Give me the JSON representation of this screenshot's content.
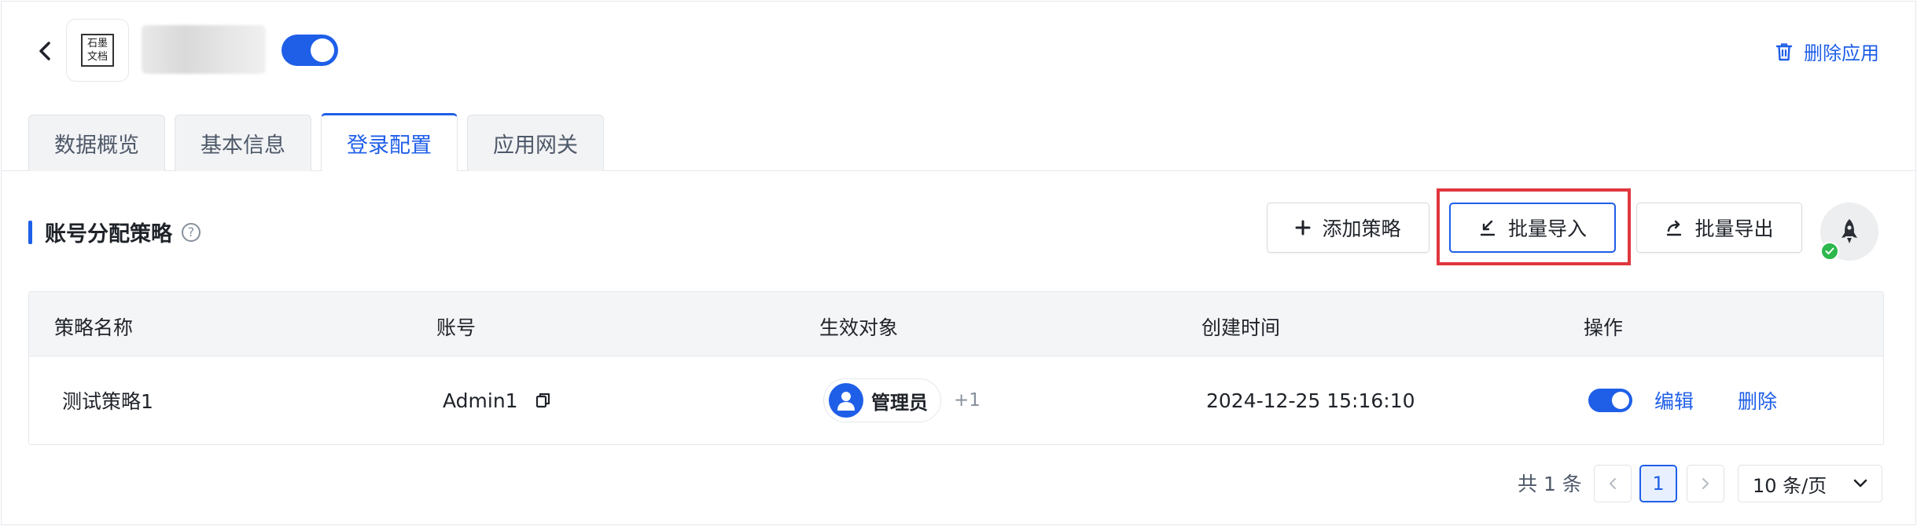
{
  "header": {
    "logo_text_line1": "石墨",
    "logo_text_line2": "文档",
    "app_enabled": true,
    "delete_app_label": "删除应用"
  },
  "tabs": [
    {
      "label": "数据概览",
      "active": false
    },
    {
      "label": "基本信息",
      "active": false
    },
    {
      "label": "登录配置",
      "active": true
    },
    {
      "label": "应用网关",
      "active": false
    }
  ],
  "section": {
    "title": "账号分配策略",
    "help_glyph": "?"
  },
  "toolbar": {
    "add_label": "添加策略",
    "import_label": "批量导入",
    "export_label": "批量导出"
  },
  "table": {
    "columns": [
      "策略名称",
      "账号",
      "生效对象",
      "创建时间",
      "操作"
    ],
    "rows": [
      {
        "name": "测试策略1",
        "account": "Admin1",
        "target": "管理员",
        "target_more": "+1",
        "created": "2024-12-25 15:16:10",
        "enabled": true,
        "edit": "编辑",
        "delete": "删除"
      }
    ]
  },
  "pagination": {
    "total_text": "共 1 条",
    "current_page": "1",
    "page_size": "10 条/页"
  },
  "colors": {
    "accent": "#1f5fe8",
    "highlight": "#e0373e",
    "success": "#2db84d"
  }
}
